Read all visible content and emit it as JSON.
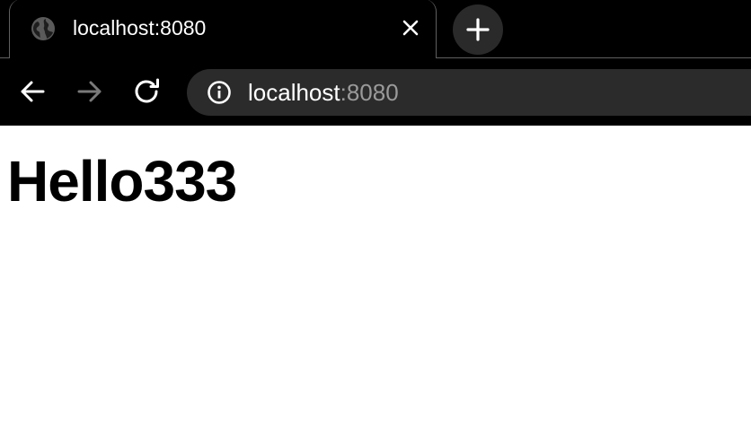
{
  "tabs": [
    {
      "title": "localhost:8080",
      "favicon": "globe-icon",
      "active": true
    }
  ],
  "toolbar": {
    "url_host": "localhost",
    "url_port": ":8080"
  },
  "page": {
    "heading": "Hello333"
  },
  "colors": {
    "chrome_bg": "#000000",
    "omnibox_bg": "#2b2b2b",
    "text_primary": "#ffffff",
    "text_dim": "#9a9a9a",
    "forward_disabled": "#7a7a7a"
  }
}
